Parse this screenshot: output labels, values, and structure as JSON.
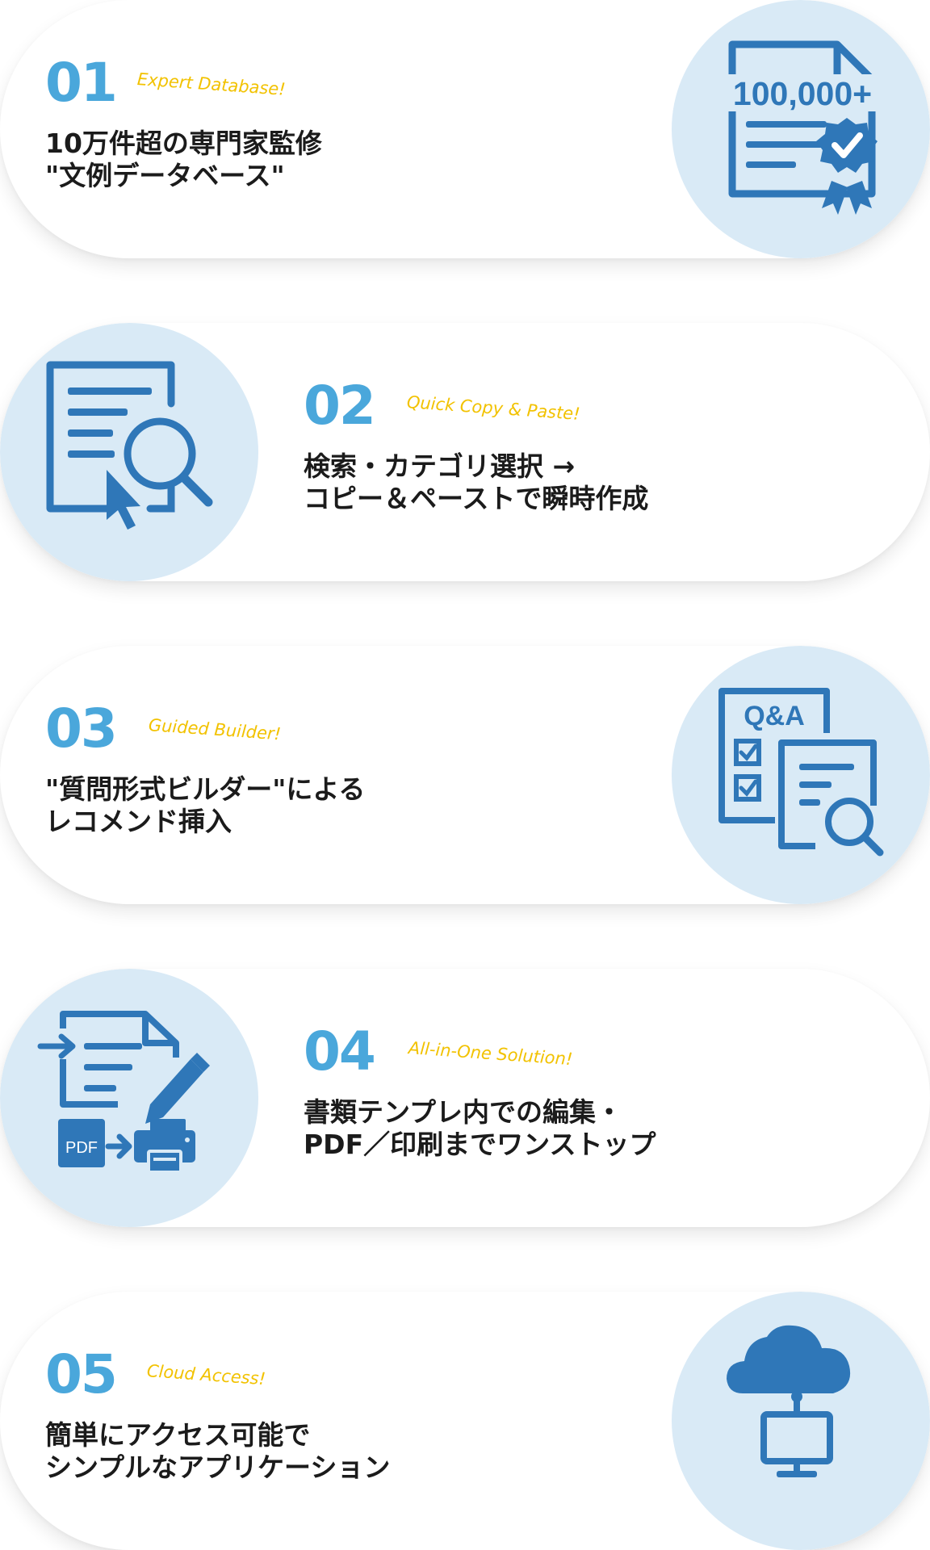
{
  "features": [
    {
      "number": "01",
      "tagline": "Expert Database!",
      "line1": "10万件超の専門家監修",
      "line2": "\"文例データベース\"",
      "icon": "certified-document-icon",
      "badge_text": "100,000+"
    },
    {
      "number": "02",
      "tagline": "Quick Copy & Paste!",
      "line1": "検索・カテゴリ選択 →",
      "line2": "コピー＆ペーストで瞬時作成",
      "icon": "document-search-icon"
    },
    {
      "number": "03",
      "tagline": "Guided Builder!",
      "line1": "\"質問形式ビルダー\"による",
      "line2": "レコメンド挿入",
      "icon": "qa-builder-icon",
      "badge_text": "Q&A"
    },
    {
      "number": "04",
      "tagline": "All-in-One Solution!",
      "line1": "書類テンプレ内での編集・",
      "line2": "PDF／印刷までワンストップ",
      "icon": "edit-pdf-print-icon",
      "badge_text": "PDF"
    },
    {
      "number": "05",
      "tagline": "Cloud Access!",
      "line1": "簡単にアクセス可能で",
      "line2": "シンプルなアプリケーション",
      "icon": "cloud-computer-icon"
    }
  ],
  "colors": {
    "accent_blue": "#4aa7db",
    "icon_blue": "#2f77b8",
    "circle_bg": "#d9eaf6",
    "tagline_yellow": "#f2c200",
    "text": "#1b1b1b"
  }
}
